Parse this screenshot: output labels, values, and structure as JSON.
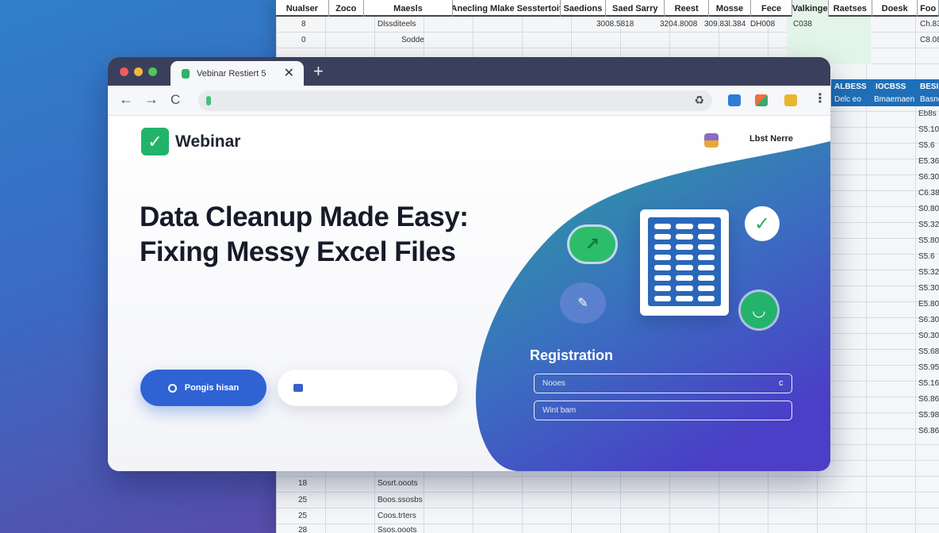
{
  "spreadsheet": {
    "headers": [
      {
        "label": "Nualser",
        "w": 70
      },
      {
        "label": "Zoco",
        "w": 46
      },
      {
        "label": "Maesls",
        "w": 118
      },
      {
        "label": "Anecling Mlake Sesstertoit",
        "w": 142
      },
      {
        "label": "Saedions",
        "w": 60
      },
      {
        "label": "Saed Sarry",
        "w": 78
      },
      {
        "label": "Reest",
        "w": 58
      },
      {
        "label": "Mosse",
        "w": 56
      },
      {
        "label": "Fece",
        "w": 54
      },
      {
        "label": "Valkinge",
        "w": 48
      },
      {
        "label": "Raetses",
        "w": 58
      },
      {
        "label": "Doesk",
        "w": 60
      },
      {
        "label": "Foo",
        "w": 28
      }
    ],
    "rows": [
      {
        "a": "8",
        "c": "Dlssditeels",
        "f": "3008.5818",
        "g": "3204.8008",
        "h": "309.83l.384",
        "i": "DH008",
        "j": "C038",
        "m": "Ch.83"
      },
      {
        "a": "0",
        "c": "Sodde",
        "m": "C8.08"
      }
    ],
    "blue_band": [
      "ALBESS",
      "IOCBSS",
      "BESI",
      "Delc eo",
      "Bmaemaen",
      "Basno"
    ],
    "right_values": [
      "Eb8s",
      "S5.10",
      "S5.6",
      "E5.36",
      "S6.30",
      "C6.38",
      "S0.80",
      "S5.32",
      "S5.80",
      "S5.6",
      "S5.32",
      "S5.30",
      "E5.80",
      "S6.30",
      "S0.30",
      "S5.68",
      "S5.95",
      "S5.16",
      "S6.86",
      "S5.98",
      "S6.86"
    ],
    "bottom_rows": [
      {
        "a": "18",
        "c": "Sosrt.ooots"
      },
      {
        "a": "25",
        "c": "Boos.ssosbs"
      },
      {
        "a": "25",
        "c": "Coos.trters"
      },
      {
        "a": "28",
        "c": "Ssos.ooots"
      }
    ]
  },
  "browser": {
    "tab_title": "Vebinar Restiert 5",
    "close_glyph": "✕",
    "new_tab_glyph": "+",
    "nav": {
      "back": "←",
      "forward": "→",
      "reload": "C"
    },
    "url_ext_glyph": "♻",
    "menu_glyph": "⋮"
  },
  "brand": {
    "logo_glyph": "✓",
    "name": "Webinar"
  },
  "user": {
    "name": "Lbst Nerre"
  },
  "hero": {
    "headline_line1": "Data Cleanup Made Easy:",
    "headline_line2": "Fixing Messy Excel Files"
  },
  "cta": {
    "primary_label": "Pongis hisan"
  },
  "illustration": {
    "check_glyph": "✓",
    "chart_glyph": "↗",
    "link_glyph": "✎",
    "smile_glyph": "◡"
  },
  "registration": {
    "title": "Registration",
    "field1_placeholder": "Nooes",
    "field1_icon": "c",
    "field2_placeholder": "Wint bam"
  },
  "colors": {
    "accent": "#2f63d4",
    "brand_green": "#22b36a",
    "wave_start": "#2aa39a",
    "wave_end": "#4a3fc6"
  }
}
